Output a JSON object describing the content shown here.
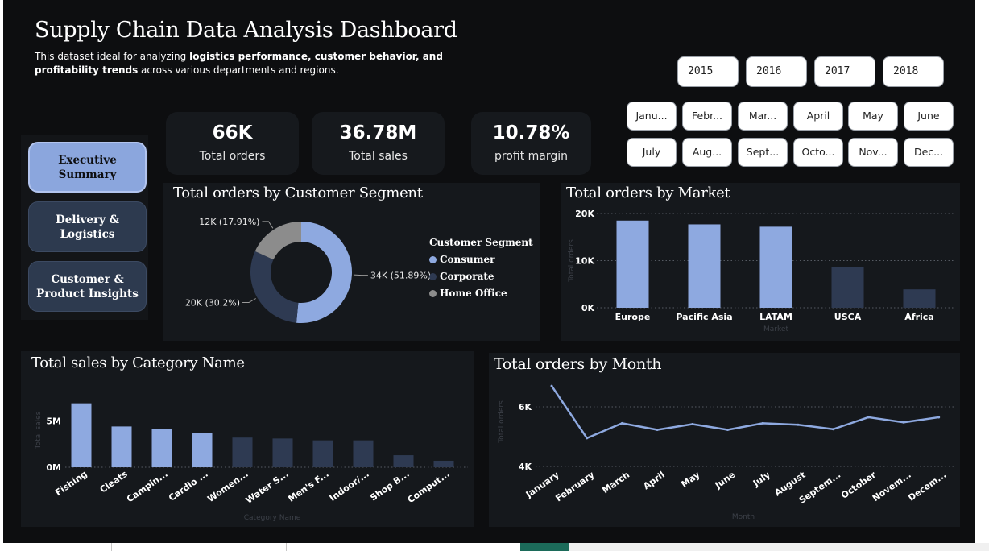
{
  "header": {
    "title": "Supply Chain Data Analysis Dashboard",
    "subtitle_pre": "This dataset ideal for analyzing ",
    "subtitle_bold": "logistics performance, customer behavior, and profitability trends",
    "subtitle_post": " across various departments and regions."
  },
  "filters": {
    "years": [
      "2015",
      "2016",
      "2017",
      "2018"
    ],
    "months": [
      "Janu...",
      "Febr...",
      "Mar...",
      "April",
      "May",
      "June",
      "July",
      "Aug...",
      "Sept...",
      "Octo...",
      "Nov...",
      "Dec..."
    ]
  },
  "nav": {
    "items": [
      {
        "label": "Executive Summary",
        "active": true
      },
      {
        "label": "Delivery & Logistics",
        "active": false
      },
      {
        "label": "Customer & Product Insights",
        "active": false
      }
    ]
  },
  "kpis": [
    {
      "value": "66K",
      "label": "Total orders"
    },
    {
      "value": "36.78M",
      "label": "Total sales"
    },
    {
      "value": "10.78%",
      "label": "profit margin"
    }
  ],
  "colors": {
    "accent": "#8ea9e0",
    "dark_bar": "#2e3a52",
    "home_office": "#8c8c8c",
    "background": "#0d0e10",
    "panel": "#15181c"
  },
  "segment": {
    "title": "Total orders by Customer Segment",
    "legend_title": "Customer Segment"
  },
  "market": {
    "title": "Total orders by Market"
  },
  "category": {
    "title": "Total sales by Category Name"
  },
  "month": {
    "title": "Total orders by Month"
  },
  "chart_data": [
    {
      "type": "pie",
      "donut": true,
      "title": "Total orders by Customer Segment",
      "legend_title": "Customer Segment",
      "categories": [
        "Consumer",
        "Corporate",
        "Home Office"
      ],
      "values": [
        34000,
        20000,
        12000
      ],
      "percent": [
        51.89,
        30.2,
        17.91
      ],
      "data_labels": [
        "34K (51.89%)",
        "20K (30.2%)",
        "12K (17.91%)"
      ],
      "colors": [
        "#8ea9e0",
        "#2e3a52",
        "#8c8c8c"
      ]
    },
    {
      "type": "bar",
      "title": "Total orders by Market",
      "xlabel": "Market",
      "ylabel": "Total orders",
      "categories": [
        "Europe",
        "Pacific Asia",
        "LATAM",
        "USCA",
        "Africa"
      ],
      "values": [
        18500,
        17700,
        17200,
        8600,
        3900
      ],
      "highlight": [
        true,
        true,
        true,
        false,
        false
      ],
      "ylim": [
        0,
        20000
      ],
      "yticks": [
        0,
        10000,
        20000
      ],
      "ytick_labels": [
        "0K",
        "10K",
        "20K"
      ],
      "grid": true
    },
    {
      "type": "bar",
      "title": "Total sales by Category Name",
      "xlabel": "Category Name",
      "ylabel": "Total sales",
      "categories": [
        "Fishing",
        "Cleats",
        "Campin...",
        "Cardio ...",
        "Women...",
        "Water S...",
        "Men's F...",
        "Indoor/...",
        "Shop B...",
        "Comput..."
      ],
      "values": [
        6900000,
        4400000,
        4100000,
        3700000,
        3200000,
        3100000,
        2900000,
        2900000,
        1300000,
        700000
      ],
      "highlight": [
        true,
        true,
        true,
        true,
        false,
        false,
        false,
        false,
        false,
        false
      ],
      "ylim": [
        0,
        8000000
      ],
      "yticks": [
        0,
        5000000
      ],
      "ytick_labels": [
        "0M",
        "5M"
      ],
      "grid": true
    },
    {
      "type": "line",
      "title": "Total orders by Month",
      "xlabel": "Month",
      "ylabel": "Total orders",
      "categories": [
        "January",
        "February",
        "March",
        "April",
        "May",
        "June",
        "July",
        "August",
        "Septem...",
        "October",
        "Novem...",
        "Decem..."
      ],
      "values": [
        6700,
        4950,
        5450,
        5230,
        5420,
        5230,
        5450,
        5400,
        5250,
        5650,
        5480,
        5650
      ],
      "ylim": [
        4000,
        7000
      ],
      "yticks": [
        4000,
        6000
      ],
      "ytick_labels": [
        "4K",
        "6K"
      ],
      "grid": true
    }
  ]
}
